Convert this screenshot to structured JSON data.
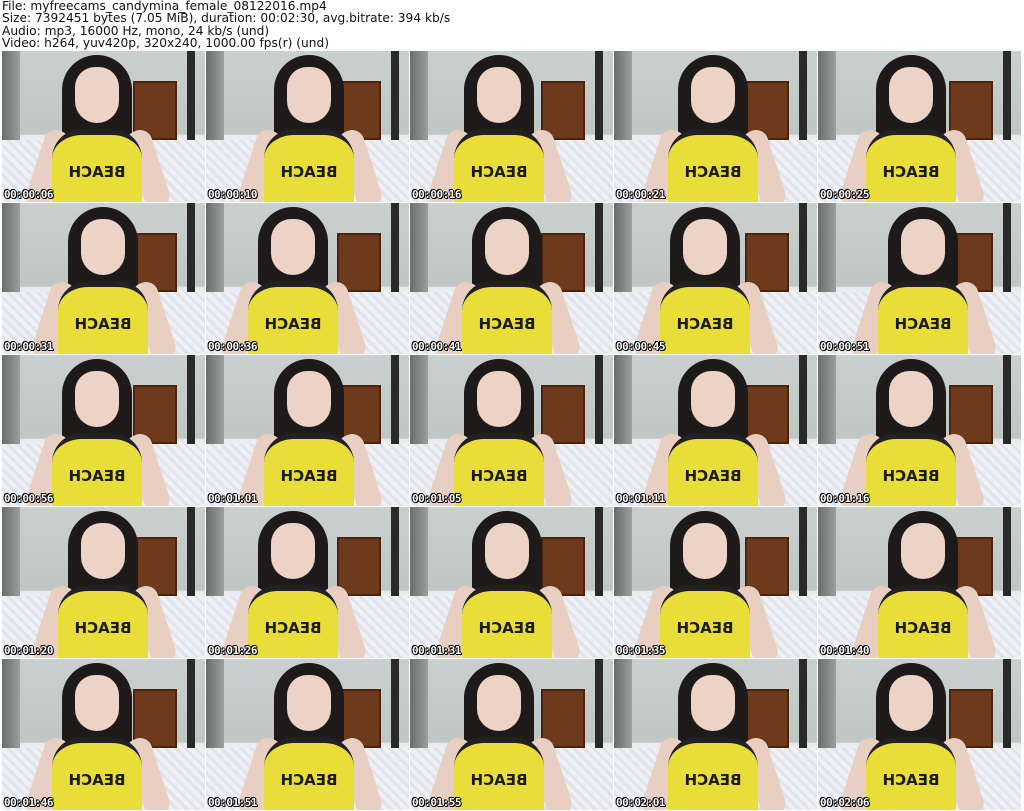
{
  "header": {
    "file": "File: myfreecams_candymina_female_08122016.mp4",
    "size": "Size: 7392451 bytes (7.05 MiB), duration: 00:02:30, avg.bitrate: 394 kb/s",
    "audio": "Audio: mp3, 16000 Hz, mono, 24 kb/s (und)",
    "video": "Video: h264, yuv420p, 320x240, 1000.00 fps(r) (und)"
  },
  "shirt_text": "BEACH",
  "thumbnails": [
    "00:00:06",
    "00:00:10",
    "00:00:16",
    "00:00:21",
    "00:00:25",
    "00:00:31",
    "00:00:36",
    "00:00:41",
    "00:00:45",
    "00:00:51",
    "00:00:56",
    "00:01:01",
    "00:01:05",
    "00:01:11",
    "00:01:16",
    "00:01:20",
    "00:01:26",
    "00:01:31",
    "00:01:35",
    "00:01:40",
    "00:01:46",
    "00:01:51",
    "00:01:55",
    "00:02:01",
    "00:02:06"
  ]
}
